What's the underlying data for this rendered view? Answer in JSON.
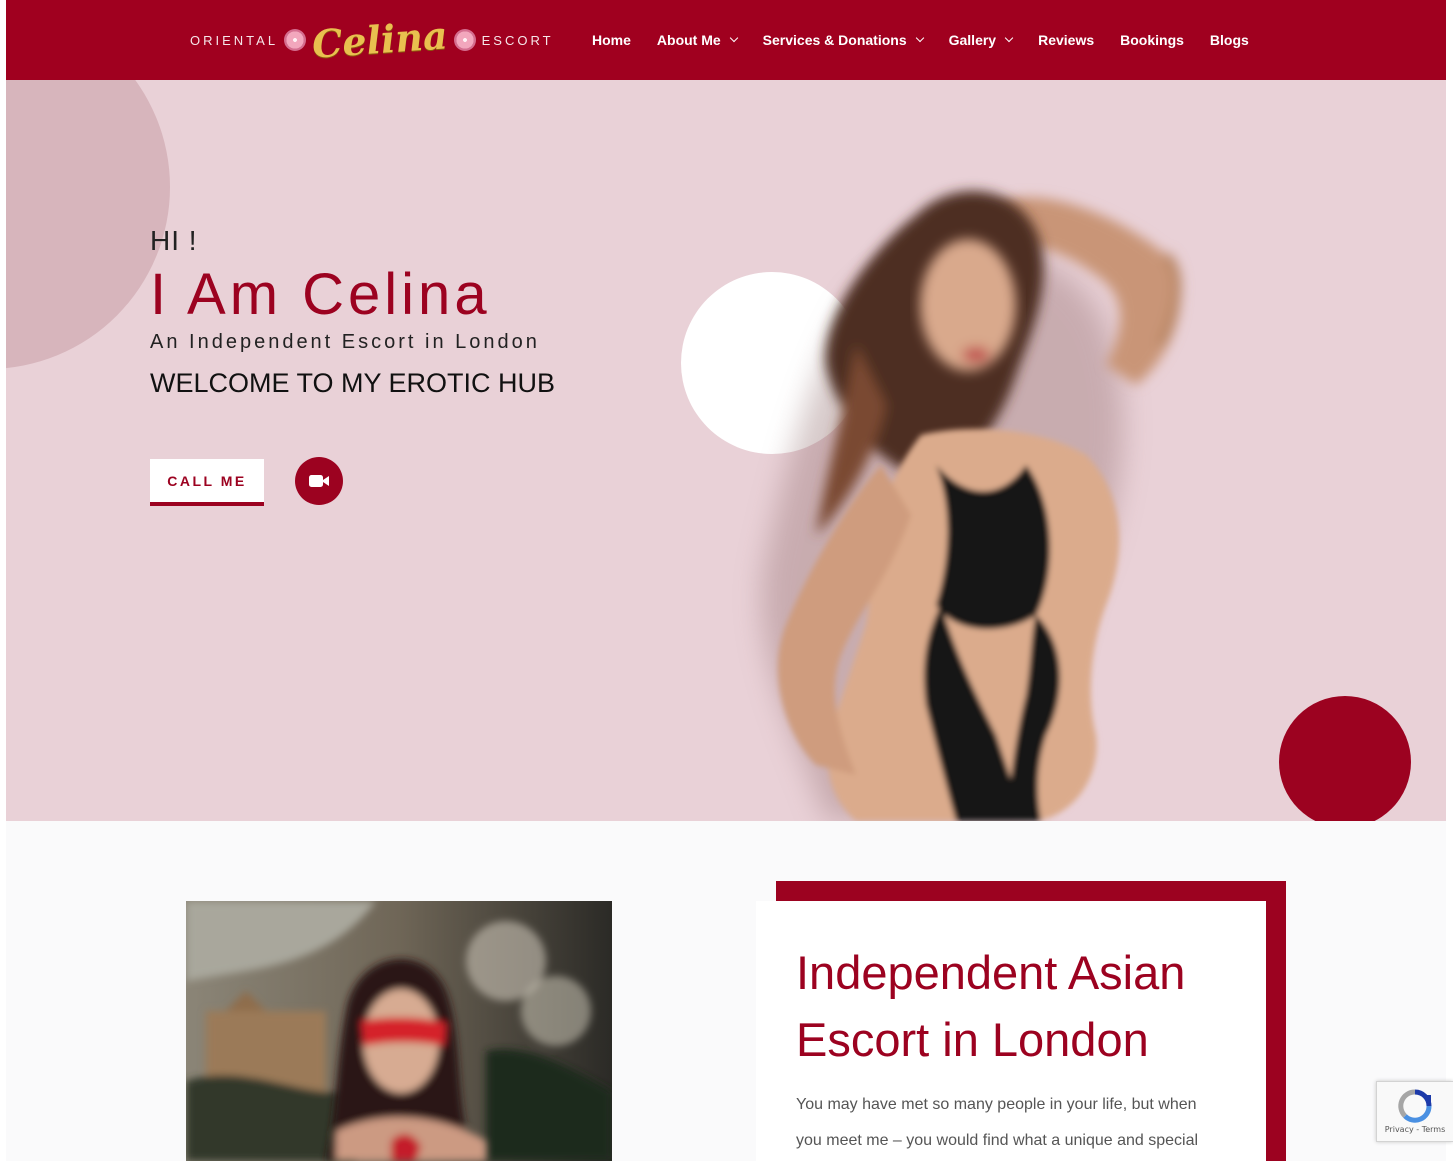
{
  "header": {
    "logo": {
      "left_text": "ORIENTAL",
      "name": "Celina",
      "right_text": "ESCORT"
    },
    "nav": [
      {
        "label": "Home",
        "dropdown": false
      },
      {
        "label": "About Me",
        "dropdown": true
      },
      {
        "label": "Services & Donations",
        "dropdown": true
      },
      {
        "label": "Gallery",
        "dropdown": true
      },
      {
        "label": "Reviews",
        "dropdown": false
      },
      {
        "label": "Bookings",
        "dropdown": false
      },
      {
        "label": "Blogs",
        "dropdown": false
      }
    ]
  },
  "hero": {
    "greeting": "HI !",
    "name": "I Am Celina",
    "subtitle": "An Independent Escort in London",
    "welcome": "WELCOME TO MY EROTIC HUB",
    "call_button": "CALL ME",
    "video_icon": "video-camera-icon"
  },
  "about": {
    "title": "Independent Asian Escort in London",
    "text": "You may have met so many people in your life, but when you meet me – you would find what a unique and special"
  },
  "recaptcha": {
    "terms": "Privacy - Terms"
  },
  "colors": {
    "brand": "#a0001f",
    "accent": "#9c0220",
    "hero_bg": "#e9d1d7"
  }
}
